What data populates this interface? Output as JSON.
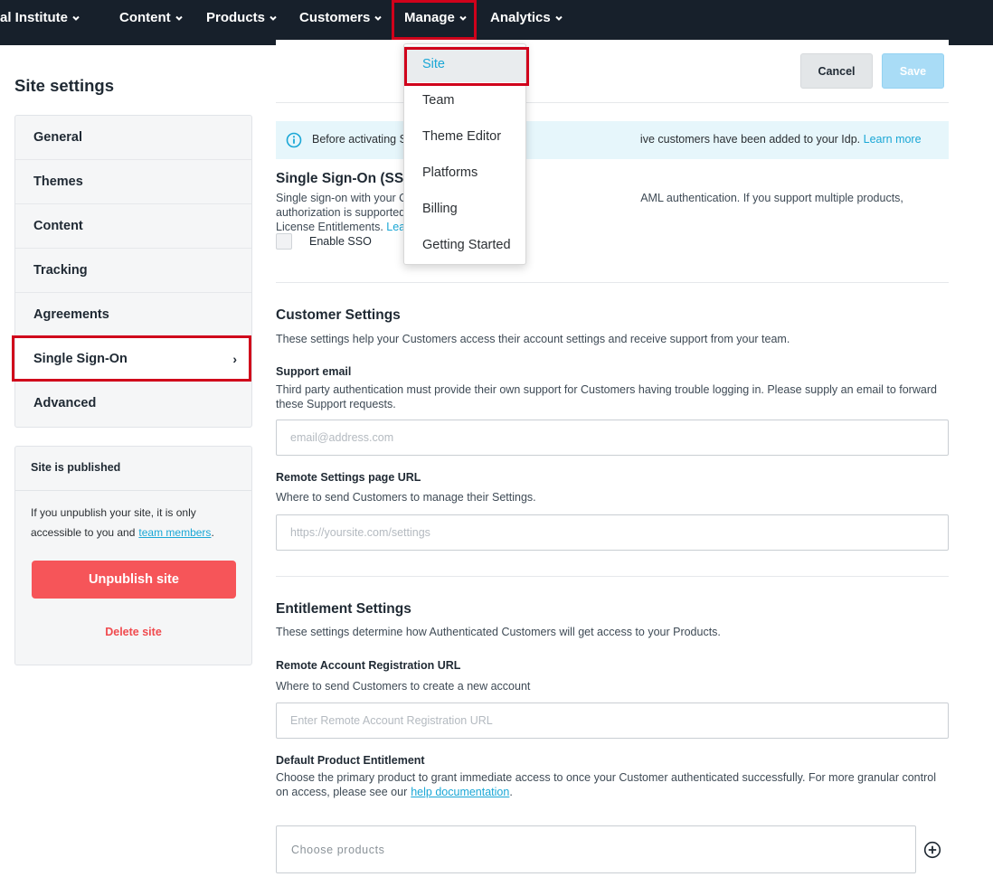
{
  "nav": {
    "items": [
      {
        "label": "al Institute"
      },
      {
        "label": "Content"
      },
      {
        "label": "Products"
      },
      {
        "label": "Customers"
      },
      {
        "label": "Manage"
      },
      {
        "label": "Analytics"
      }
    ]
  },
  "dropdown": {
    "items": [
      "Site",
      "Team",
      "Theme Editor",
      "Platforms",
      "Billing",
      "Getting Started"
    ],
    "active": "Site"
  },
  "sidebar": {
    "title": "Site settings",
    "items": [
      "General",
      "Themes",
      "Content",
      "Tracking",
      "Agreements",
      "Single Sign-On",
      "Advanced"
    ],
    "active": "Single Sign-On",
    "active_arrow": "›"
  },
  "publish": {
    "heading": "Site is published",
    "text": "If you unpublish your site, it is only accessible to you and",
    "link": "team members",
    "suffix": ".",
    "unpublish_label": "Unpublish site",
    "delete_label": "Delete site"
  },
  "toolbar": {
    "cancel_label": "Cancel",
    "save_label": "Save"
  },
  "info": {
    "text_start": "Before activating S",
    "text_end": "ive customers have been added to your Idp.",
    "link": "Learn more"
  },
  "sso": {
    "title": "Single Sign-On (SSO",
    "desc_line1_start": "Single sign-on with your C",
    "desc_line1_end": "AML authentication. If you support multiple products, authorization is supported by",
    "desc_line2": "License Entitlements.",
    "desc_link": "Lea",
    "checkbox_label": "Enable SSO"
  },
  "customer": {
    "title": "Customer Settings",
    "desc": "These settings help your Customers access their account settings and receive support from your team.",
    "support_label": "Support email",
    "support_desc": "Third party authentication must provide their own support for Customers having trouble logging in. Please supply an email to forward these Support requests.",
    "support_placeholder": "email@address.com",
    "remote_label": "Remote Settings page URL",
    "remote_desc": "Where to send Customers to manage their Settings.",
    "remote_placeholder": "https://yoursite.com/settings"
  },
  "entitlement": {
    "title": "Entitlement Settings",
    "desc": "These settings determine how Authenticated Customers will get access to your Products.",
    "reg_label": "Remote Account Registration URL",
    "reg_desc": "Where to send Customers to create a new account",
    "reg_placeholder": "Enter Remote Account Registration URL",
    "default_label": "Default Product Entitlement",
    "default_desc": "Choose the primary product to grant immediate access to once your Customer authenticated successfully. For more granular control on access, please see our",
    "default_link": "help documentation",
    "default_suffix": ".",
    "choose_placeholder": "Choose products"
  },
  "colors": {
    "nav_bg": "#17202b",
    "accent": "#1aa7d6",
    "danger": "#f65559",
    "highlight": "#d0021b"
  }
}
